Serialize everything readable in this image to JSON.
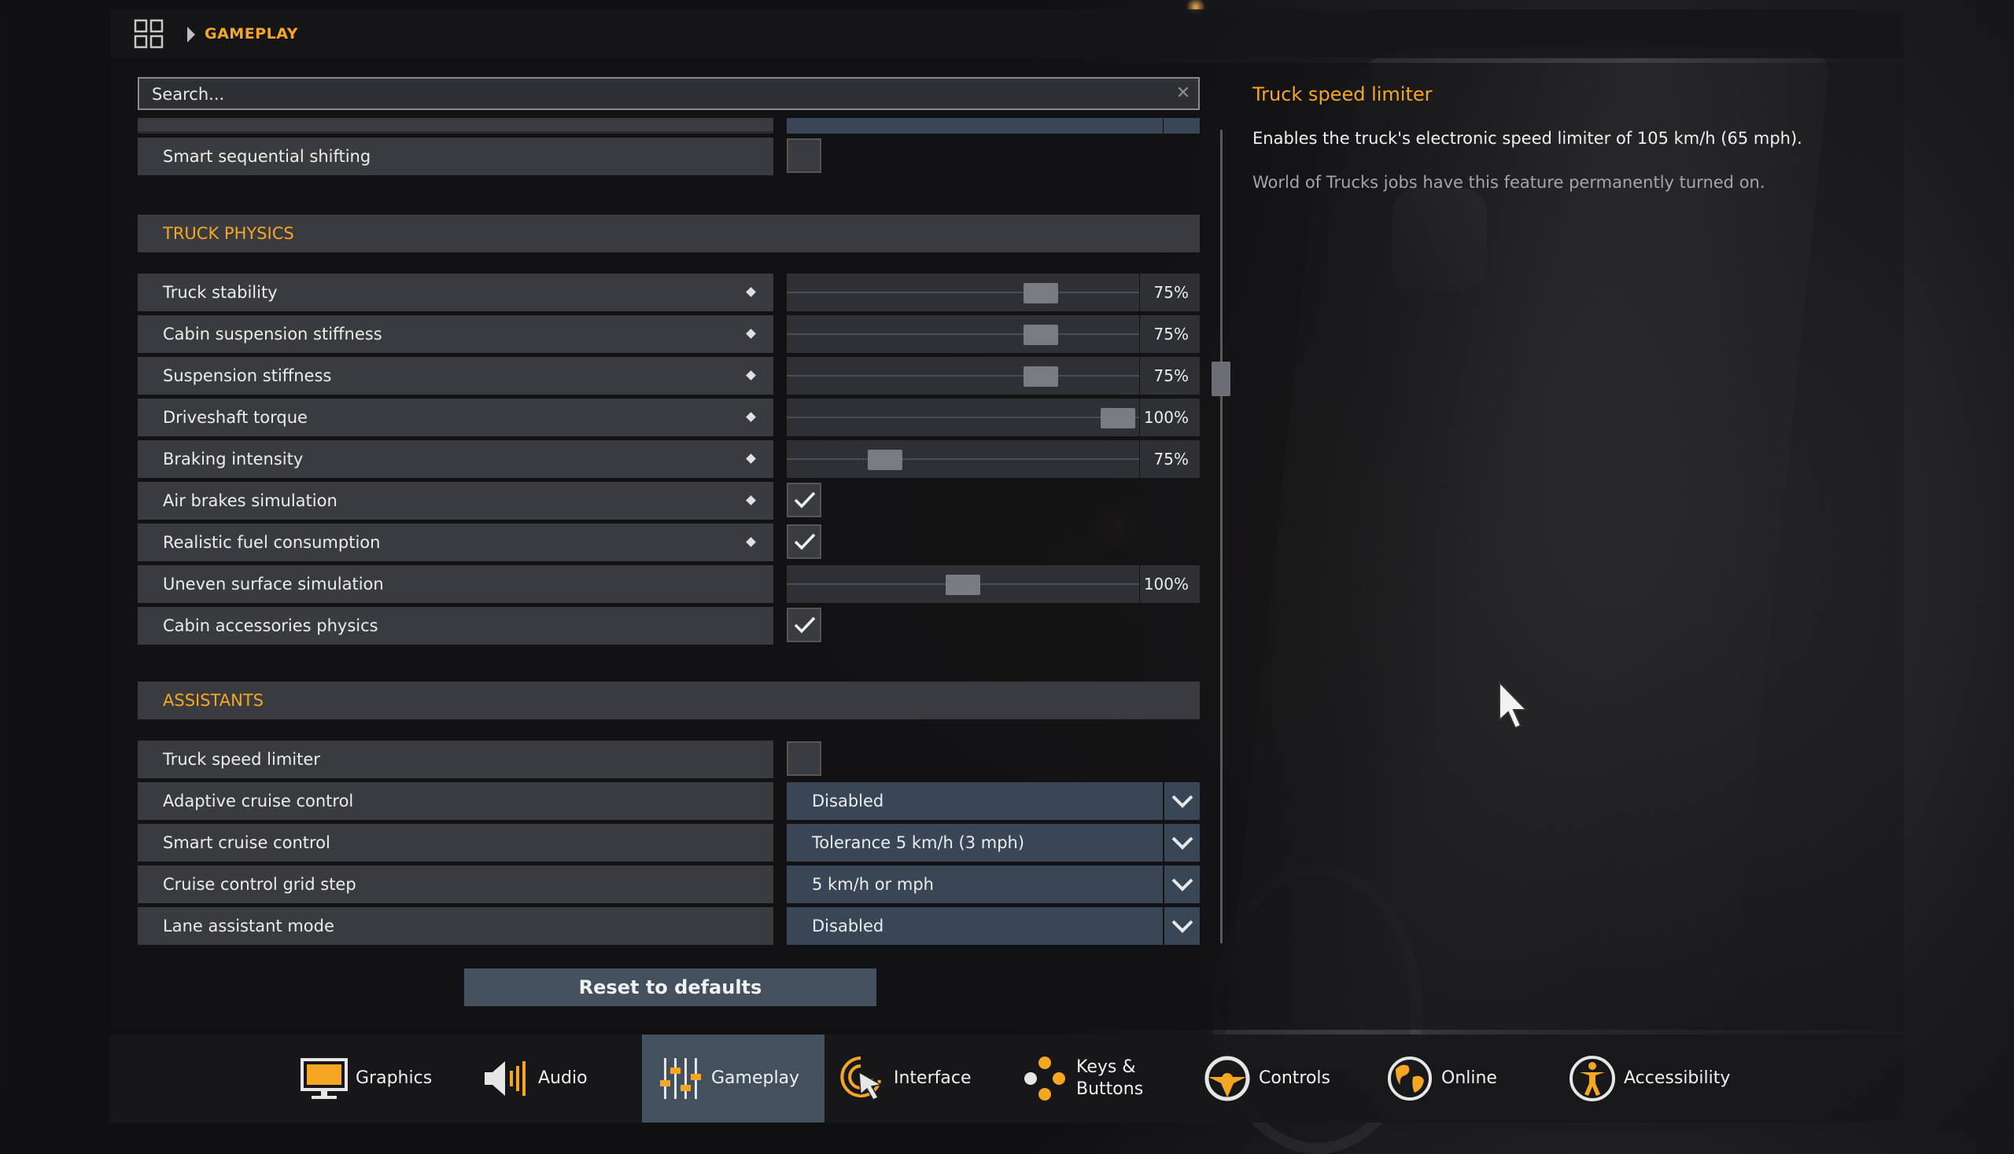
{
  "breadcrumb": {
    "current": "GAMEPLAY"
  },
  "search": {
    "placeholder": "Search..."
  },
  "rows_top": [
    {
      "label": "Smart sequential shifting",
      "checked": false
    }
  ],
  "sections": {
    "truck_physics": "TRUCK PHYSICS",
    "assistants": "ASSISTANTS"
  },
  "truck_physics": [
    {
      "label": "Truck stability",
      "type": "slider",
      "value": "75%",
      "level": 0.72
    },
    {
      "label": "Cabin suspension stiffness",
      "type": "slider",
      "value": "75%",
      "level": 0.72
    },
    {
      "label": "Suspension stiffness",
      "type": "slider",
      "value": "75%",
      "level": 0.72
    },
    {
      "label": "Driveshaft torque",
      "type": "slider",
      "value": "100%",
      "level": 0.94
    },
    {
      "label": "Braking intensity",
      "type": "slider",
      "value": "75%",
      "level": 0.28
    },
    {
      "label": "Air brakes simulation",
      "type": "checkbox",
      "checked": true
    },
    {
      "label": "Realistic fuel consumption",
      "type": "checkbox",
      "checked": true
    },
    {
      "label": "Uneven surface simulation",
      "type": "slider",
      "value": "100%",
      "level": 0.5
    },
    {
      "label": "Cabin accessories physics",
      "type": "checkbox",
      "checked": true
    }
  ],
  "assistants": [
    {
      "label": "Truck speed limiter",
      "type": "checkbox",
      "checked": false
    },
    {
      "label": "Adaptive cruise control",
      "type": "dropdown",
      "value": "Disabled"
    },
    {
      "label": "Smart cruise control",
      "type": "dropdown",
      "value": "Tolerance 5 km/h (3 mph)"
    },
    {
      "label": "Cruise control grid step",
      "type": "dropdown",
      "value": "5 km/h or mph"
    },
    {
      "label": "Lane assistant mode",
      "type": "dropdown",
      "value": "Disabled"
    }
  ],
  "reset_label": "Reset to defaults",
  "info": {
    "title": "Truck speed limiter",
    "description": "Enables the truck's electronic speed limiter of 105 km/h (65 mph).",
    "note": "World of Trucks jobs have this feature permanently turned on."
  },
  "nav": [
    {
      "label": "Graphics",
      "icon": "monitor-icon"
    },
    {
      "label": "Audio",
      "icon": "speaker-icon"
    },
    {
      "label": "Gameplay",
      "icon": "sliders-icon",
      "active": true
    },
    {
      "label": "Interface",
      "icon": "pointer-icon"
    },
    {
      "label": "Keys &\nButtons",
      "icon": "gamepad-buttons-icon"
    },
    {
      "label": "Controls",
      "icon": "steering-wheel-icon"
    },
    {
      "label": "Online",
      "icon": "globe-icon"
    },
    {
      "label": "Accessibility",
      "icon": "accessibility-icon"
    }
  ],
  "colors": {
    "accent": "#f5a623",
    "dropdown": "#394656",
    "row": "#3a3b3f",
    "active_tab": "#43505e"
  }
}
